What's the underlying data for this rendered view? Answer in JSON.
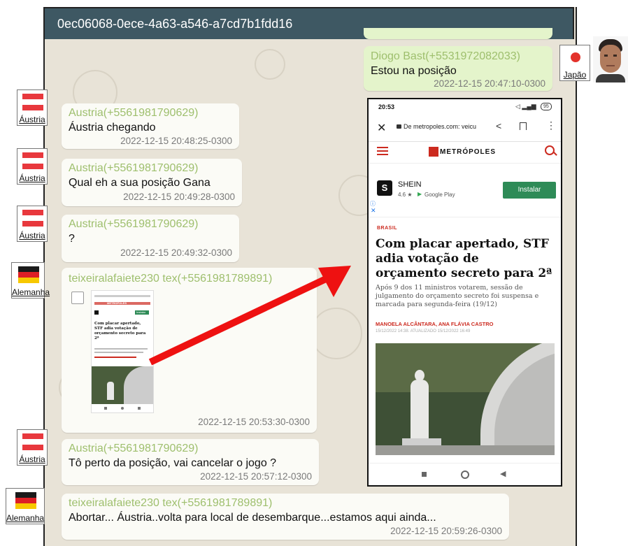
{
  "header": {
    "title": "0ec06068-0ece-4a63-a546-a7cd7b1fdd16"
  },
  "contacts": {
    "austria": {
      "label": "Áustria"
    },
    "germany": {
      "label": "Alemanha"
    },
    "japan": {
      "label": "Japão"
    }
  },
  "messages": [
    {
      "sender": "Diogo Bast(+5531972082033)",
      "text": "Estou na posição",
      "time": "2022-12-15 20:47:10-0300"
    },
    {
      "sender": "Austria(+5561981790629)",
      "text": "Áustria chegando",
      "time": "2022-12-15 20:48:25-0300"
    },
    {
      "sender": "Austria(+5561981790629)",
      "text": "Qual eh a sua posição Gana",
      "time": "2022-12-15 20:49:28-0300"
    },
    {
      "sender": "Austria(+5561981790629)",
      "text": "?",
      "time": "2022-12-15 20:49:32-0300"
    },
    {
      "sender": "teixeiralafaiete230 tex(+5561981789891)",
      "text": "",
      "time": "2022-12-15 20:53:30-0300"
    },
    {
      "sender": "Austria(+5561981790629)",
      "text": "Tô perto da posição, vai cancelar o jogo ?",
      "time": "2022-12-15 20:57:12-0300"
    },
    {
      "sender": "teixeiralafaiete230 tex(+5561981789891)",
      "text": "Abortar... Áustria..volta para local de desembarque...estamos aqui ainda...",
      "time": "2022-12-15 20:59:26-0300"
    }
  ],
  "phone": {
    "status_time": "20:53",
    "battery": "95",
    "url": "De metropoles.com: veicu",
    "site_name": "METRÓPOLES",
    "ad": {
      "brand": "SHEIN",
      "rating": "4.6 ★",
      "store": "Google Play",
      "cta": "Instalar",
      "badge": "S"
    },
    "article": {
      "section": "BRASIL",
      "headline": "Com placar apertado, STF adia votação de orçamento secreto para 2ª",
      "summary": "Após 9 dos 11 ministros votarem, sessão de julgamento do orçamento secreto foi suspensa e marcada para segunda-feira (19/12)",
      "authors": "MANOELA ALCÂNTARA, ANA FLÁVIA CASTRO",
      "dateline": "15/12/2022 14:38. ATUALIZADO 15/12/2022 16:49"
    }
  },
  "thumbnail": {
    "headline": "Com placar apertado, STF adia votação de orçamento secreto para 2ª",
    "site_name": "METRÓPOLES",
    "cta": "Instalar"
  },
  "colors": {
    "header": "#3e5863",
    "sender": "#9ebf6d",
    "arrow": "#ee1111",
    "outgoing": "#e4f4cb",
    "incoming": "#fbfbf6",
    "brand_red": "#cc2a1f",
    "install_green": "#2e8b57"
  }
}
